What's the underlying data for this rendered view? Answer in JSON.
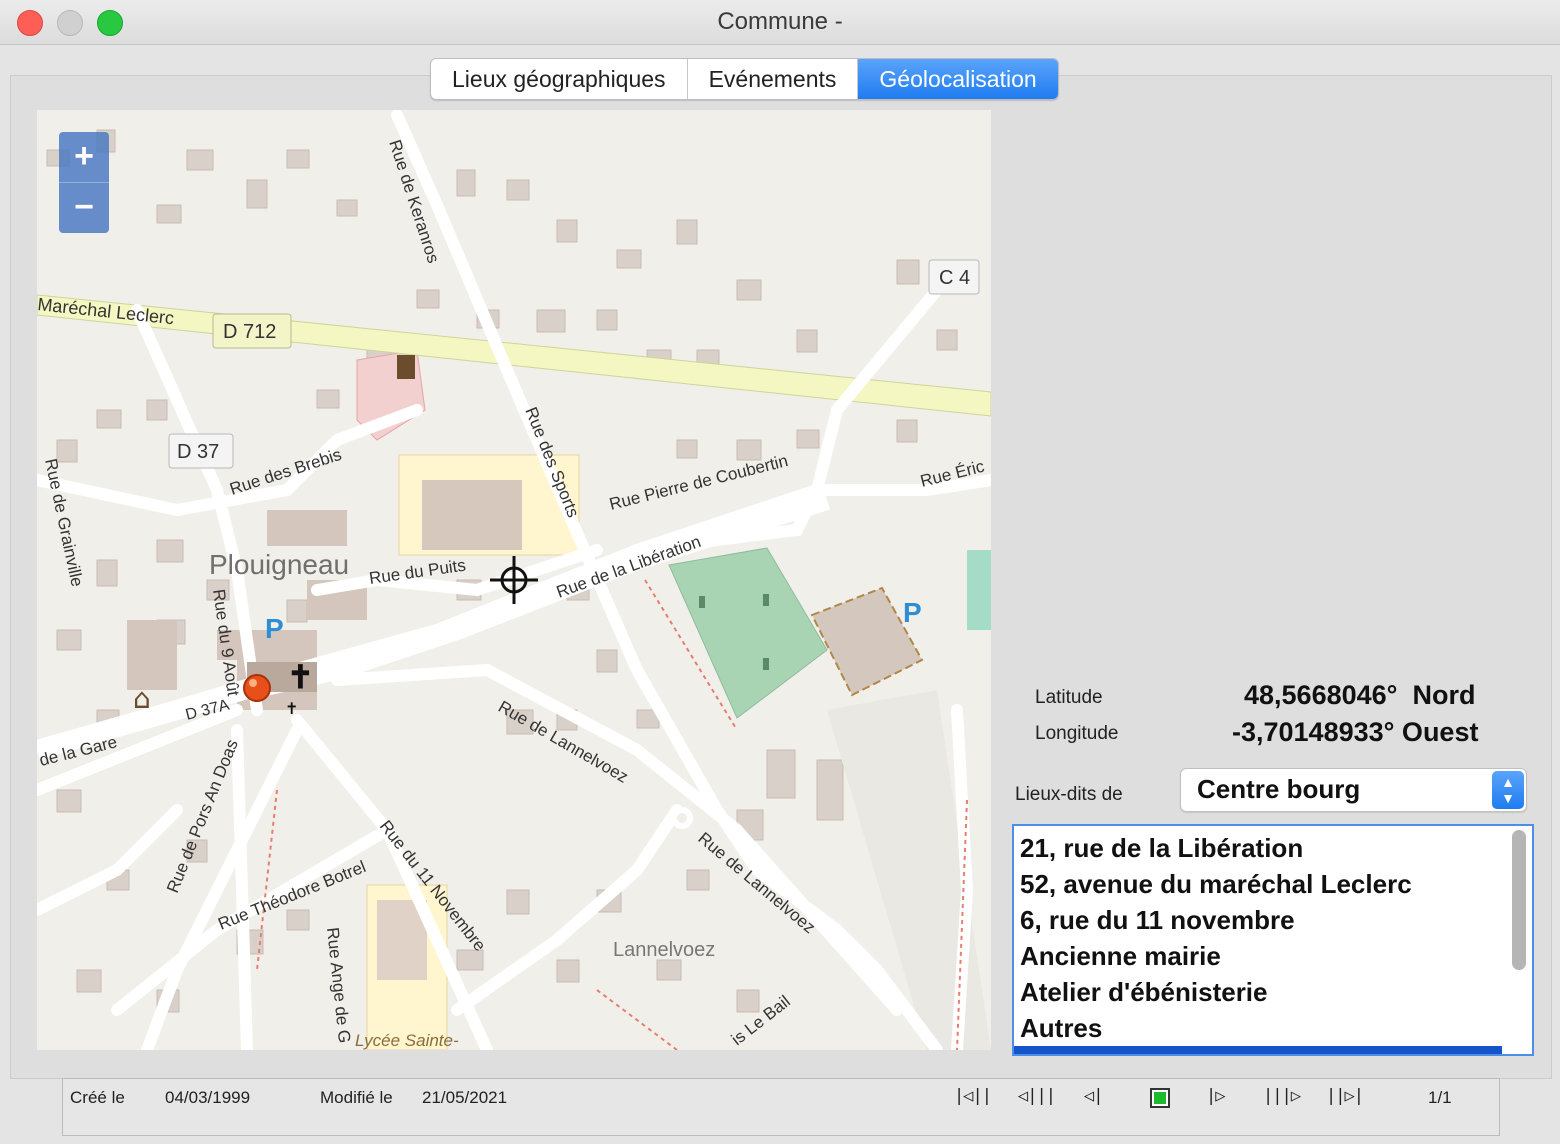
{
  "window": {
    "title": "Commune -"
  },
  "tabs": [
    {
      "label": "Lieux géographiques"
    },
    {
      "label": "Evénements"
    },
    {
      "label": "Géolocalisation"
    }
  ],
  "map": {
    "zoom_in": "+",
    "zoom_out": "−",
    "labels": {
      "marechal": "Maréchal Leclerc",
      "d712": "D 712",
      "c4": "C 4",
      "d37": "D 37",
      "d37a": "D 37A",
      "keranroux": "Rue de Keranros",
      "brebis": "Rue des Brebis",
      "sports": "Rue des Sports",
      "coubertin": "Rue Pierre de Coubertin",
      "eric": "Rue Éric",
      "grainville": "Rue de Grainville",
      "plouigneau": "Plouigneau",
      "puits": "Rue du Puits",
      "liberation": "Rue de la Libération",
      "rue9aout": "Rue du 9 Août",
      "gare": "de la Gare",
      "porsandoas": "Rue de Pors An Doas",
      "lannelvoez1": "Rue de Lannelvoez",
      "lannelvoez2": "Rue de Lannelvoez",
      "onzenov": "Rue du 11 Novembre",
      "botrel": "Rue Théodore Botrel",
      "angede": "Rue Ange de G",
      "lannelvoez_place": "Lannelvoez",
      "lycee": "Lycée Sainte-",
      "lebail": "is Le Bail",
      "p1": "P",
      "p2": "P"
    }
  },
  "geo": {
    "lat_label": "Latitude",
    "lat_value": "48,5668046°  Nord",
    "lon_label": "Longitude",
    "lon_value": "-3,70148933° Ouest",
    "lieux_label": "Lieux-dits de",
    "lieux_selected": "Centre bourg",
    "list": [
      "21, rue de la Libération",
      "52, avenue du maréchal Leclerc",
      "6, rue du 11 novembre",
      "Ancienne mairie",
      "Atelier d'ébénisterie",
      "Autres"
    ]
  },
  "footer": {
    "cree_label": "Créé le",
    "cree_date": "04/03/1999",
    "modifie_label": "Modifié le",
    "modifie_date": "21/05/2021",
    "nav": [
      "|◁||",
      "◁|||",
      "◁|",
      "|▷",
      "|||▷",
      "||▷|"
    ],
    "page": "1/1"
  },
  "colors": {
    "accent": "#1f7cf0",
    "map_bg": "#f1efe9",
    "marker": "#e8501a"
  }
}
